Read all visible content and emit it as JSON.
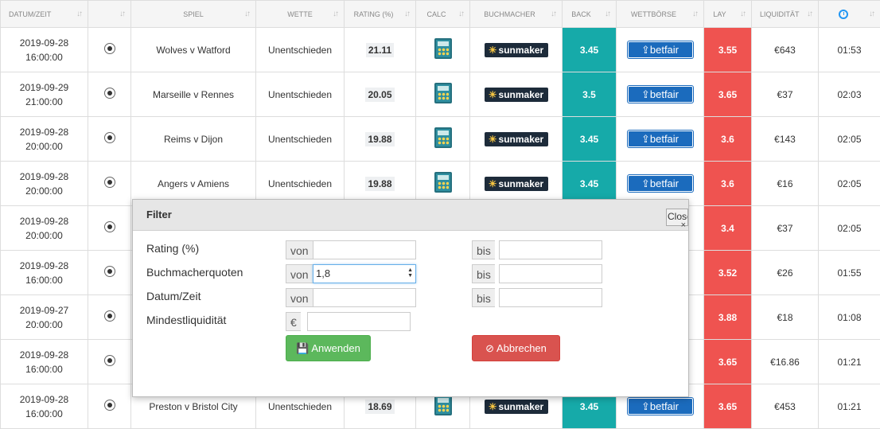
{
  "headers": {
    "date": "DATUM/ZEIT",
    "sport": "",
    "match": "SPIEL",
    "bet": "WETTE",
    "rating": "RATING (%)",
    "calc": "CALC",
    "bookmaker": "BUCHMACHER",
    "back": "BACK",
    "exchange": "WETTBÖRSE",
    "lay": "LAY",
    "liquidity": "LIQUIDITÄT"
  },
  "sort_glyph": "↓↑",
  "rows": [
    {
      "date": "2019-09-28",
      "time": "16:00:00",
      "match": "Wolves v Watford",
      "bet": "Unentschieden",
      "rating": "21.11",
      "bookmaker": "sunmaker",
      "back": "3.45",
      "exchange": "betfair",
      "lay": "3.55",
      "liquidity": "€643",
      "elapsed": "01:53"
    },
    {
      "date": "2019-09-29",
      "time": "21:00:00",
      "match": "Marseille v Rennes",
      "bet": "Unentschieden",
      "rating": "20.05",
      "bookmaker": "sunmaker",
      "back": "3.5",
      "exchange": "betfair",
      "lay": "3.65",
      "liquidity": "€37",
      "elapsed": "02:03"
    },
    {
      "date": "2019-09-28",
      "time": "20:00:00",
      "match": "Reims v Dijon",
      "bet": "Unentschieden",
      "rating": "19.88",
      "bookmaker": "sunmaker",
      "back": "3.45",
      "exchange": "betfair",
      "lay": "3.6",
      "liquidity": "€143",
      "elapsed": "02:05"
    },
    {
      "date": "2019-09-28",
      "time": "20:00:00",
      "match": "Angers v Amiens",
      "bet": "Unentschieden",
      "rating": "19.88",
      "bookmaker": "sunmaker",
      "back": "3.45",
      "exchange": "betfair",
      "lay": "3.6",
      "liquidity": "€16",
      "elapsed": "02:05"
    },
    {
      "date": "2019-09-28",
      "time": "20:00:00",
      "match": "",
      "bet": "",
      "rating": "",
      "bookmaker": "",
      "back": "",
      "exchange": "",
      "lay": "3.4",
      "liquidity": "€37",
      "elapsed": "02:05"
    },
    {
      "date": "2019-09-28",
      "time": "16:00:00",
      "match": "",
      "bet": "",
      "rating": "",
      "bookmaker": "",
      "back": "",
      "exchange": "",
      "lay": "3.52",
      "liquidity": "€26",
      "elapsed": "01:55"
    },
    {
      "date": "2019-09-27",
      "time": "20:00:00",
      "match": "",
      "bet": "",
      "rating": "",
      "bookmaker": "",
      "back": "",
      "exchange": "",
      "lay": "3.88",
      "liquidity": "€18",
      "elapsed": "01:08"
    },
    {
      "date": "2019-09-28",
      "time": "16:00:00",
      "match": "",
      "bet": "",
      "rating": "",
      "bookmaker": "",
      "back": "",
      "exchange": "",
      "lay": "3.65",
      "liquidity": "€16.86",
      "elapsed": "01:21"
    },
    {
      "date": "2019-09-28",
      "time": "16:00:00",
      "match": "Preston v Bristol City",
      "bet": "Unentschieden",
      "rating": "18.69",
      "bookmaker": "sunmaker",
      "back": "3.45",
      "exchange": "betfair",
      "lay": "3.65",
      "liquidity": "€453",
      "elapsed": "01:21"
    }
  ],
  "filter": {
    "title": "Filter",
    "close_label": "Close",
    "close_x": "×",
    "rating_label": "Rating (%)",
    "odds_label": "Buchmacherquoten",
    "date_label": "Datum/Zeit",
    "liquidity_label": "Mindestliquidität",
    "from": "von",
    "to": "bis",
    "currency": "€",
    "odds_from_value": "1,8",
    "apply_label": "Anwenden",
    "cancel_label": "Abbrechen"
  },
  "colors": {
    "back": "#16aaa9",
    "lay": "#ef5350",
    "apply": "#5cb85c",
    "cancel": "#d9534f"
  }
}
